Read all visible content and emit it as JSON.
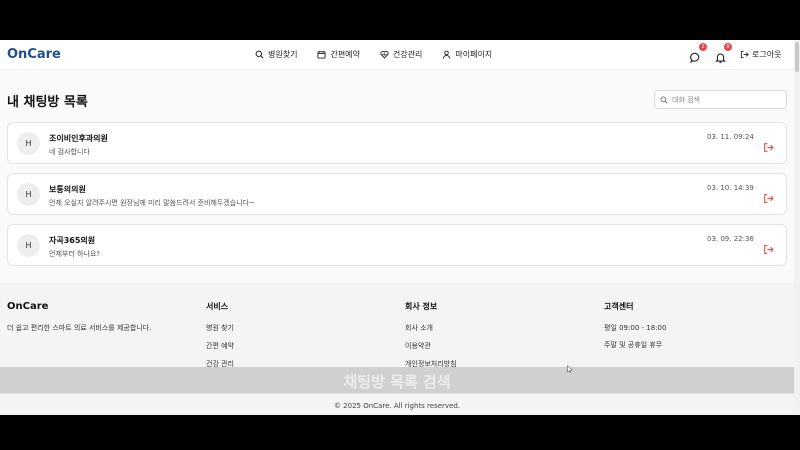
{
  "header": {
    "logo": "OnCare",
    "nav": [
      {
        "label": "병원찾기",
        "icon": "search-icon"
      },
      {
        "label": "간편예약",
        "icon": "calendar-icon"
      },
      {
        "label": "건강관리",
        "icon": "heart-icon"
      },
      {
        "label": "마이페이지",
        "icon": "user-icon"
      }
    ],
    "chat_badge": "1",
    "notification_badge": "0",
    "logout_label": "로그아웃"
  },
  "main": {
    "title": "내 채팅방 목록",
    "search_placeholder": "대화 검색",
    "chats": [
      {
        "avatar": "H",
        "name": "조이비인후과의원",
        "message": "네 검사합니다",
        "time": "03. 11. 09:24"
      },
      {
        "avatar": "H",
        "name": "보통의의원",
        "message": "언제 오실지 알려주시면 원장님께 미리 말씀드려서 준비해두겠습니다~",
        "time": "03. 10. 14:39"
      },
      {
        "avatar": "H",
        "name": "자곡365의원",
        "message": "언제부터 하나요?",
        "time": "03. 09. 22:36"
      }
    ]
  },
  "footer": {
    "logo": "OnCare",
    "description": "더 쉽고 편리한 스마트 의료 서비스를 제공합니다.",
    "services": {
      "title": "서비스",
      "links": [
        "병원 찾기",
        "간편 예약",
        "건강 관리"
      ]
    },
    "company": {
      "title": "회사 정보",
      "links": [
        "회사 소개",
        "이용약관",
        "개인정보처리방침"
      ]
    },
    "support": {
      "title": "고객센터",
      "lines": [
        "평일 09:00 - 18:00",
        "주말 및 공휴일 휴무"
      ]
    },
    "overlay_caption": "채팅방 목록 검색",
    "copyright": "© 2025 OnCare. All rights reserved."
  },
  "colors": {
    "brand": "#1e4f8f",
    "badge": "#e5484d",
    "leave_icon": "#d9534f"
  }
}
